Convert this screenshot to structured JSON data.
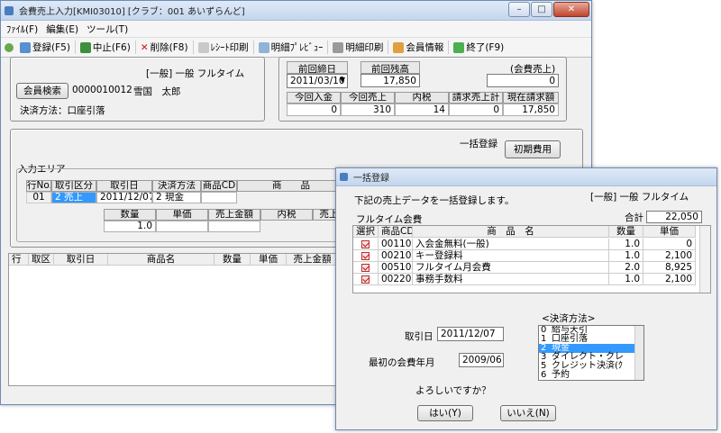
{
  "main_window": {
    "title": "会費売上入力[KMI03010] [クラブ：001 あいずらんど]",
    "menu": [
      "ﾌｧｲﾙ(F)",
      "編集(E)",
      "ツール(T)"
    ],
    "toolbar": [
      "登録(F5)",
      "中止(F6)",
      "削除(F8)",
      "ﾚｼｰﾄ印刷",
      "明細ﾌﾟﾚﾋﾞｭｰ",
      "明細印刷",
      "会員情報",
      "終了(F9)"
    ],
    "member": {
      "category": "[一般] 一般 フルタイム",
      "search_button": "会員検索",
      "member_id": "0000010012",
      "member_name": "雪国　太郎",
      "payment_label": "決済方法：口座引落"
    },
    "summary": {
      "last_date_label": "前回締日",
      "last_date_value": "2011/03/10",
      "last_balance_label": "前回残高",
      "last_balance_value": "17,850",
      "sales_label": "(会費売上)",
      "sales_value": "0",
      "headers": [
        "今回入金",
        "今回売上",
        "内税",
        "請求売上計",
        "現在請求額"
      ],
      "values": [
        "0",
        "310",
        "14",
        "0",
        "17,850"
      ]
    },
    "bulk_label": "一括登録",
    "initial_fee_button": "初期費用",
    "input_area": {
      "legend": "入力エリア",
      "headers": [
        "行No.",
        "取引区分",
        "取引日",
        "決済方法",
        "商品CD",
        "商　　品"
      ],
      "row": [
        "01",
        "2 売上",
        "2011/12/07",
        "2 現金"
      ],
      "qty_headers": [
        "数量",
        "単価",
        "売上金額",
        "内税",
        "売上"
      ],
      "qty_value": "1.0"
    },
    "lower_grid_headers": [
      "行",
      "取区",
      "取引日",
      "商品名",
      "数量",
      "単価",
      "売上金額"
    ]
  },
  "dialog": {
    "title": "一括登録",
    "message": "下記の売上データを一括登録します。",
    "category": "[一般] 一般 フルタイム",
    "group_name": "フルタイム会費",
    "total_label": "合計",
    "total_value": "22,050",
    "headers": [
      "選択",
      "商品CD",
      "商　品　名",
      "数量",
      "単価"
    ],
    "rows": [
      {
        "code": "00110",
        "name": "入会金無料(一般)",
        "qty": "1.0",
        "price": "0"
      },
      {
        "code": "00210",
        "name": "キー登録料",
        "qty": "1.0",
        "price": "2,100"
      },
      {
        "code": "00510",
        "name": "フルタイム月会費",
        "qty": "2.0",
        "price": "8,925"
      },
      {
        "code": "00220",
        "name": "事務手数料",
        "qty": "1.0",
        "price": "2,100"
      }
    ],
    "payment_method_label": "<決済方法>",
    "payment_methods": [
      {
        "no": "0",
        "name": "給与天引"
      },
      {
        "no": "1",
        "name": "口座引落"
      },
      {
        "no": "2",
        "name": "現金"
      },
      {
        "no": "3",
        "name": "ダイレクト・クレ"
      },
      {
        "no": "5",
        "name": "クレジット決済(ｸ"
      },
      {
        "no": "6",
        "name": "予約"
      }
    ],
    "transaction_date_label": "取引日",
    "transaction_date_value": "2011/12/07",
    "first_month_label": "最初の会費年月",
    "first_month_value": "2009/06",
    "confirm_message": "よろしいですか？",
    "yes_button": "はい(Y)",
    "no_button": "いいえ(N)"
  }
}
